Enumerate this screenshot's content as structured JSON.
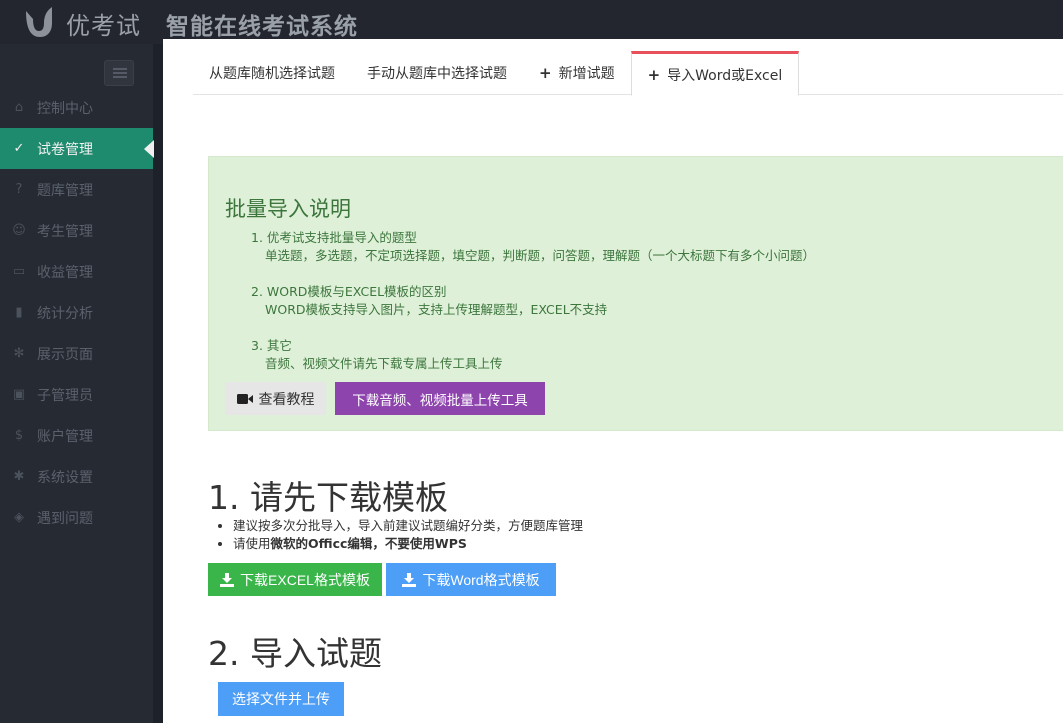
{
  "header": {
    "brand": "优考试",
    "system_name": "智能在线考试系统"
  },
  "sidebar": {
    "items": [
      {
        "label": "控制中心",
        "icon": "home-icon",
        "glyph": "⌂",
        "active": false
      },
      {
        "label": "试卷管理",
        "icon": "check-circle-icon",
        "glyph": "✓",
        "active": true
      },
      {
        "label": "题库管理",
        "icon": "question-circle-icon",
        "glyph": "?",
        "active": false
      },
      {
        "label": "考生管理",
        "icon": "users-icon",
        "glyph": "☺",
        "active": false
      },
      {
        "label": "收益管理",
        "icon": "credit-card-icon",
        "glyph": "▭",
        "active": false
      },
      {
        "label": "统计分析",
        "icon": "bar-chart-icon",
        "glyph": "▮",
        "active": false
      },
      {
        "label": "展示页面",
        "icon": "leaf-icon",
        "glyph": "✻",
        "active": false
      },
      {
        "label": "子管理员",
        "icon": "lock-icon",
        "glyph": "▣",
        "active": false
      },
      {
        "label": "账户管理",
        "icon": "dollar-icon",
        "glyph": "$",
        "active": false
      },
      {
        "label": "系统设置",
        "icon": "gear-icon",
        "glyph": "✱",
        "active": false
      },
      {
        "label": "遇到问题",
        "icon": "tag-icon",
        "glyph": "◈",
        "active": false
      }
    ]
  },
  "tabs": [
    {
      "label": "从题库随机选择试题",
      "has_plus": false,
      "active": false
    },
    {
      "label": "手动从题库中选择试题",
      "has_plus": false,
      "active": false
    },
    {
      "label": "新增试题",
      "has_plus": true,
      "active": false
    },
    {
      "label": "导入Word或Excel",
      "has_plus": true,
      "active": true
    }
  ],
  "notice": {
    "title": "批量导入说明",
    "items": [
      {
        "head": "1. 优考试支持批量导入的题型",
        "sub": "单选题，多选题，不定项选择题，填空题，判断题，问答题，理解题（一个大标题下有多个小问题）"
      },
      {
        "head": "2. WORD模板与EXCEL模板的区别",
        "sub": "WORD模板支持导入图片，支持上传理解题型，EXCEL不支持"
      },
      {
        "head": "3. 其它",
        "sub": "音频、视频文件请先下载专属上传工具上传"
      }
    ],
    "tutorial_label": "查看教程",
    "upload_tool_label": "下载音频、视频批量上传工具"
  },
  "step1": {
    "title": "1. 请先下载模板",
    "tip1": "建议按多次分批导入，导入前建议试题编好分类，方便题库管理",
    "tip2_prefix": "请使用",
    "tip2_bold": "微软的Officc编辑，不要使用WPS",
    "excel_label": "下载EXCEL格式模板",
    "word_label": "下载Word格式模板"
  },
  "step2": {
    "title": "2. 导入试题",
    "choose_label": "选择文件并上传"
  },
  "colors": {
    "active_nav": "#1e8a6e",
    "active_tab_border": "#e8505b",
    "excel_button": "#39b54a",
    "word_button": "#4d9ef7",
    "tool_button": "#8e44ad"
  }
}
